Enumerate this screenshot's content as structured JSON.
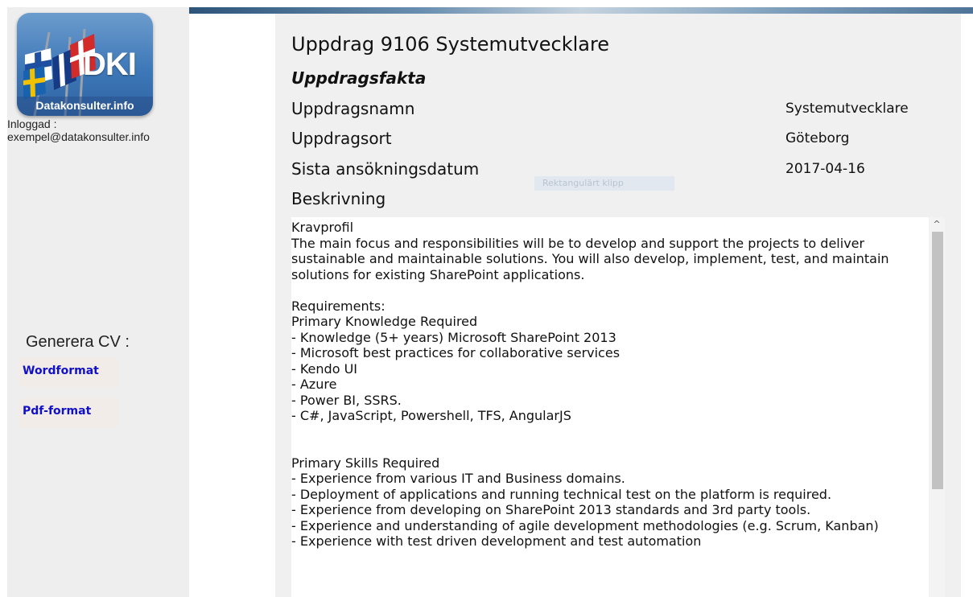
{
  "sidebar": {
    "logo": {
      "text": "DKI",
      "caption": "Datakonsulter.info"
    },
    "login_label": "Inloggad :",
    "login_email": "exempel@datakonsulter.info",
    "generate_label": "Generera CV :",
    "word_button": "Wordformat",
    "pdf_button": "Pdf-format"
  },
  "main": {
    "title": "Uppdrag 9106 Systemutvecklare",
    "subtitle": "Uppdragsfakta",
    "facts": [
      {
        "label": "Uppdragsnamn",
        "value": "Systemutvecklare"
      },
      {
        "label": "Uppdragsort",
        "value": "Göteborg"
      },
      {
        "label": "Sista ansökningsdatum",
        "value": "2017-04-16"
      }
    ],
    "description_label": "Beskrivning",
    "ghost_text": "Rektangulärt klipp",
    "description": "Kravprofil\nThe main focus and responsibilities will be to develop and support the projects to deliver sustainable and maintainable solutions. You will also develop, implement, test, and maintain solutions for existing SharePoint applications.\n\nRequirements:\nPrimary Knowledge Required\n- Knowledge (5+ years) Microsoft SharePoint 2013\n- Microsoft best practices for collaborative services\n- Kendo UI\n- Azure\n- Power BI, SSRS.\n- C#, JavaScript, Powershell, TFS, AngularJS\n\n\nPrimary Skills Required\n- Experience from various IT and Business domains.\n- Deployment of applications and running technical test on the platform is required.\n- Experience from developing on SharePoint 2013 standards and 3rd party tools.\n- Experience and understanding of agile development methodologies (e.g. Scrum, Kanban)\n- Experience with test driven development and test automation"
  },
  "colors": {
    "sidebar_bg": "#eeeeee",
    "panel_bg": "#f0f0f0",
    "link_blue": "#1010c8",
    "button_bg": "#f2ece8"
  }
}
